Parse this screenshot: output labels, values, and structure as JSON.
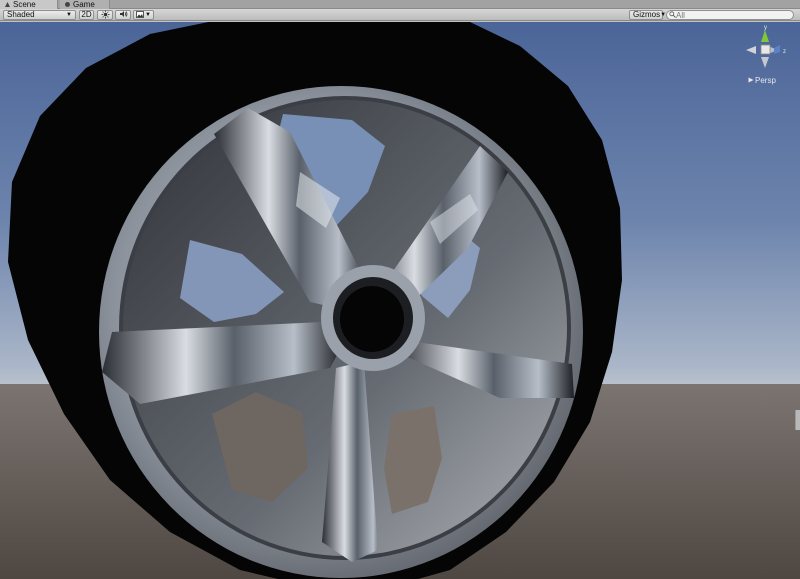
{
  "tabs": [
    {
      "label": "Scene",
      "icon": "scene-icon",
      "active": true
    },
    {
      "label": "Game",
      "icon": "game-icon",
      "active": false
    }
  ],
  "toolbar": {
    "draw_mode": "Shaded",
    "mode_2d": "2D",
    "lighting_icon": "sun-icon",
    "audio_icon": "speaker-icon",
    "effects_icon": "image-icon",
    "gizmos_label": "Gizmos",
    "search_placeholder": "All"
  },
  "gizmo": {
    "projection": "Persp",
    "axis_labels": {
      "y": "y",
      "z": "z"
    }
  },
  "colors": {
    "sky_top": "#4a6496",
    "sky_horizon": "#a9b6c9",
    "ground": "#5f5650",
    "tire": "#050505",
    "rim": "#9ea5b0"
  }
}
